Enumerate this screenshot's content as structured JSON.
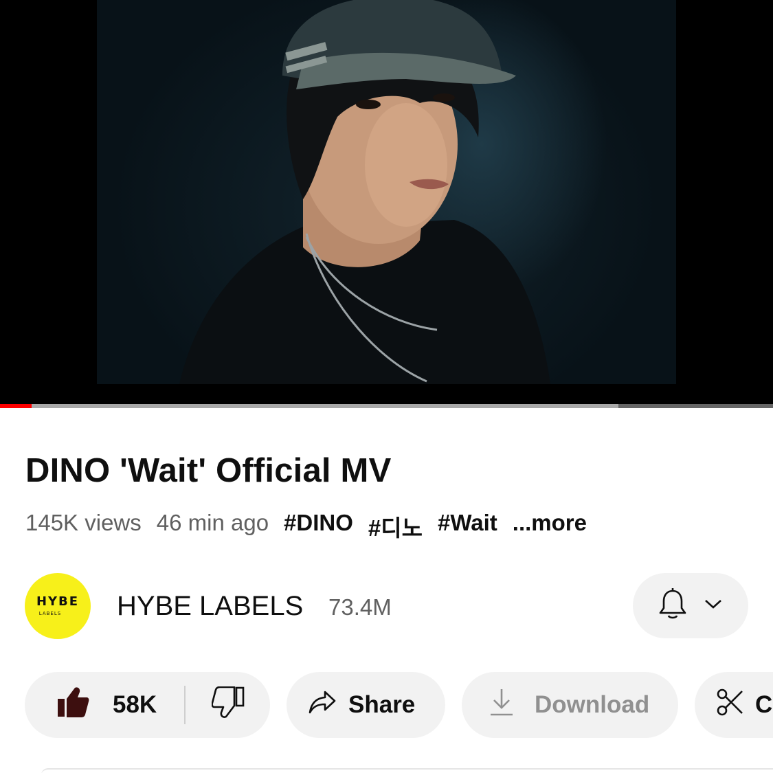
{
  "player": {
    "progress_played": 0.041,
    "progress_buffered": 0.8
  },
  "video": {
    "title": "DINO 'Wait' Official MV",
    "views": "145K views",
    "posted": "46 min ago",
    "hashtags": [
      "#DINO",
      "#디노",
      "#Wait"
    ],
    "more_label": "...more"
  },
  "channel": {
    "name": "HYBE LABELS",
    "subscribers": "73.4M",
    "avatar_logo": "HYBE",
    "avatar_sub": "LABELS",
    "avatar_color": "#f7f01a"
  },
  "actions": {
    "like_count": "58K",
    "share_label": "Share",
    "download_label": "Download",
    "clip_label": "C"
  },
  "colors": {
    "accent_red": "#ff0000",
    "pill_bg": "#f2f2f2",
    "liked_icon": "#3d0f0f",
    "muted_text": "#606060"
  },
  "icons": {
    "like": "thumbs-up-icon",
    "dislike": "thumbs-down-icon",
    "share": "share-arrow-icon",
    "download": "download-icon",
    "clip": "scissors-icon",
    "notifications": "bell-icon",
    "dropdown": "chevron-down-icon"
  }
}
